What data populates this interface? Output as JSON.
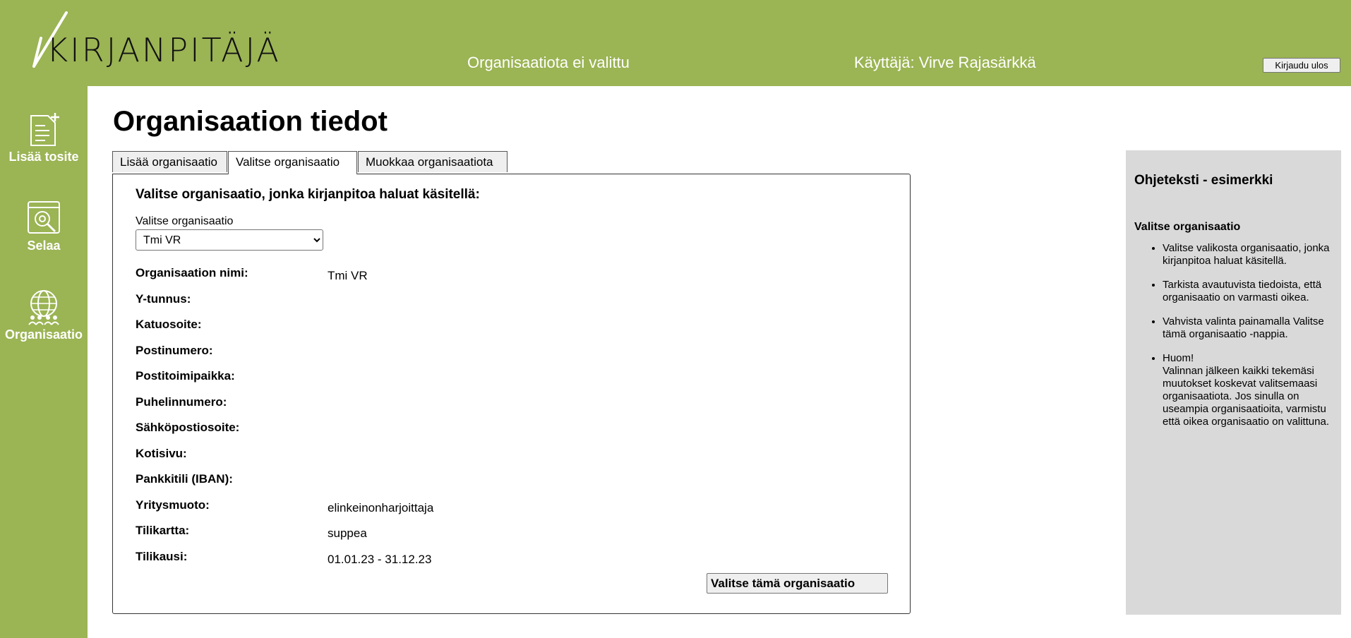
{
  "header": {
    "logo_text": "KIRJANPITÄJÄ",
    "org_status": "Organisaatiota ei valittu",
    "user_label": "Käyttäjä: Virve Rajasärkkä",
    "logout_label": "Kirjaudu ulos"
  },
  "sidebar": {
    "items": [
      {
        "label": "Lisää tosite",
        "icon": "document-plus-icon"
      },
      {
        "label": "Selaa",
        "icon": "browse-search-icon"
      },
      {
        "label": "Organisaatio",
        "icon": "organisation-globe-icon"
      }
    ]
  },
  "main": {
    "title": "Organisaation tiedot",
    "tabs": [
      {
        "label": "Lisää organisaatio",
        "active": false
      },
      {
        "label": "Valitse organisaatio",
        "active": true
      },
      {
        "label": "Muokkaa organisaatiota",
        "active": false
      }
    ],
    "heading": "Valitse organisaatio, jonka kirjanpitoa haluat käsitellä:",
    "select_label": "Valitse organisaatio",
    "select_value": "Tmi VR",
    "fields": [
      {
        "label": "Organisaation nimi:",
        "value": "Tmi VR"
      },
      {
        "label": "Y-tunnus:",
        "value": ""
      },
      {
        "label": "Katuosoite:",
        "value": ""
      },
      {
        "label": "Postinumero:",
        "value": ""
      },
      {
        "label": "Postitoimipaikka:",
        "value": ""
      },
      {
        "label": "Puhelinnumero:",
        "value": ""
      },
      {
        "label": "Sähköpostiosoite:",
        "value": ""
      },
      {
        "label": "Kotisivu:",
        "value": ""
      },
      {
        "label": "Pankkitili (IBAN):",
        "value": ""
      },
      {
        "label": "Yritysmuoto:",
        "value": "elinkeinonharjoittaja"
      },
      {
        "label": "Tilikartta:",
        "value": "suppea"
      },
      {
        "label": "Tilikausi:",
        "value": "01.01.23 - 31.12.23"
      }
    ],
    "confirm_label": "Valitse tämä organisaatio"
  },
  "help": {
    "title": "Ohjeteksti - esimerkki",
    "subtitle": "Valitse organisaatio",
    "items": [
      "Valitse valikosta organisaatio, jonka kirjanpitoa haluat käsitellä.",
      "Tarkista avautuvista tiedoista, että organisaatio on varmasti oikea.",
      "Vahvista valinta painamalla Valitse tämä organisaatio -nappia.",
      "Huom!",
      "Valinnan jälkeen kaikki tekemäsi muutokset koskevat valitsemaasi organisaatiota. Jos sinulla on useampia organisaatioita, varmistu että oikea organisaatio on valittuna."
    ]
  },
  "colors": {
    "brand_green": "#9bb454",
    "help_bg": "#d9d9d9"
  }
}
